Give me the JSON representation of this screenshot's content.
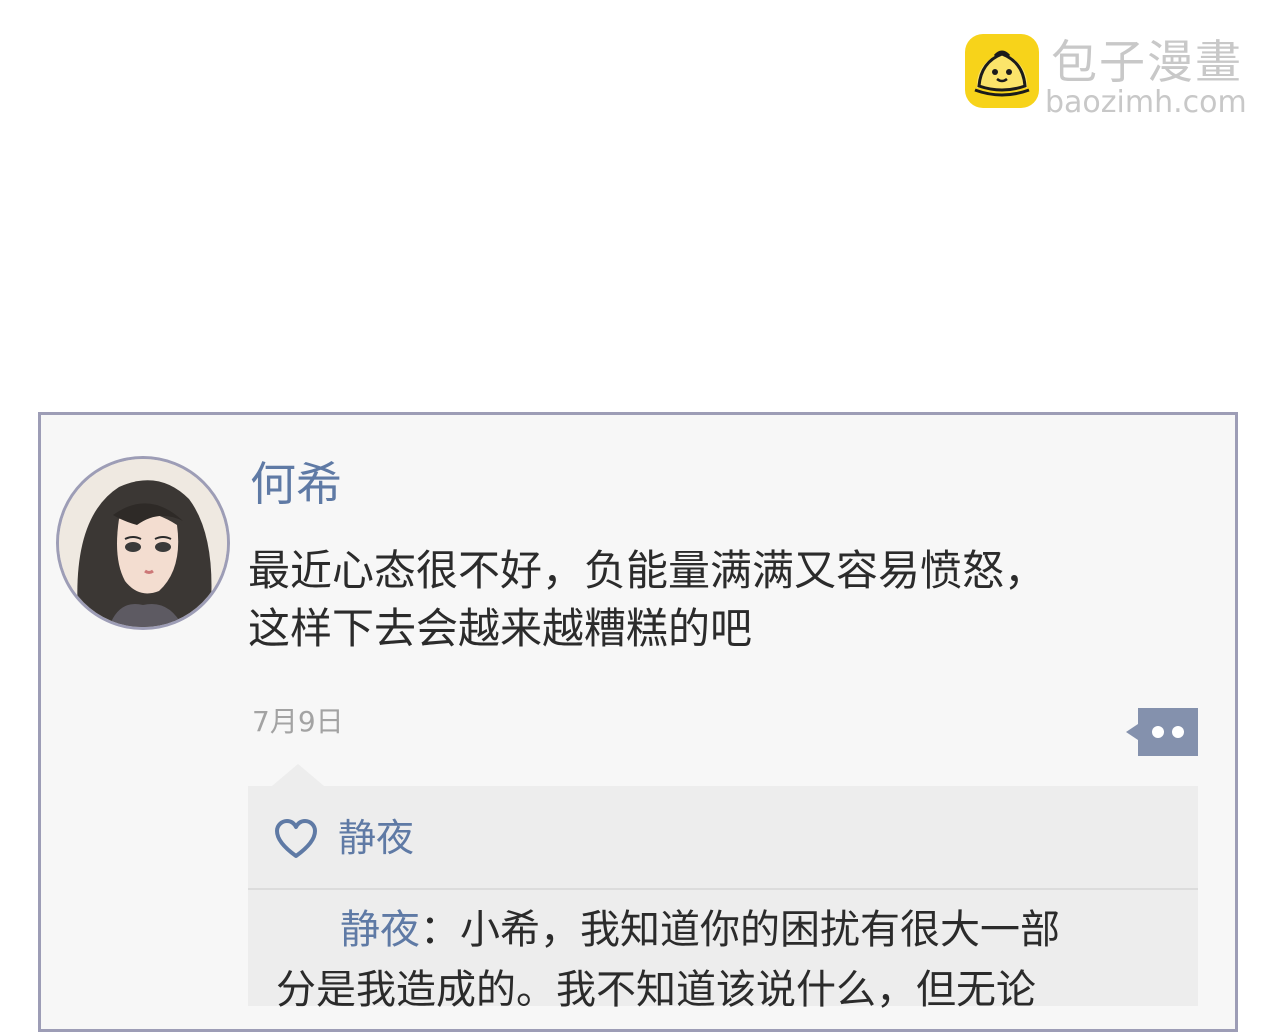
{
  "watermark": {
    "title": "包子漫畫",
    "domain": "baozimh.com"
  },
  "post": {
    "author": "何希",
    "lines": [
      "最近心态很不好，负能量满满又容易愤怒，",
      "这样下去会越来越糟糕的吧"
    ],
    "date": "7月9日"
  },
  "likes": {
    "icon": "heart-outline-icon",
    "user": "静夜"
  },
  "reply": {
    "author": "静夜",
    "separator": "：",
    "line1": "小希，我知道你的困扰有很大一部",
    "line2": "分是我造成的。我不知道该说什么，但无论"
  },
  "colors": {
    "accent": "#5f7aa5",
    "border": "#9d9db6",
    "card_bg": "#f7f7f7",
    "reply_bg": "#ededed",
    "logo_yellow": "#f7d31a"
  }
}
